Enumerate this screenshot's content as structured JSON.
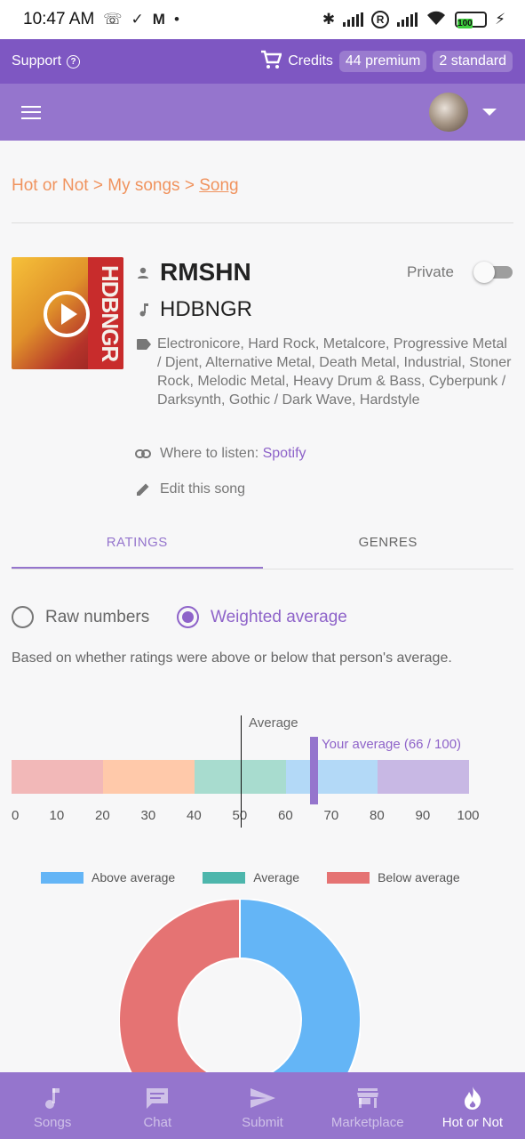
{
  "status_bar": {
    "time": "10:47 AM",
    "battery": "100"
  },
  "topbar": {
    "support_label": "Support",
    "credits_label": "Credits",
    "premium_chip": "44 premium",
    "standard_chip": "2 standard"
  },
  "breadcrumb": {
    "root": "Hot or Not",
    "sep1": " > ",
    "mid": "My songs",
    "sep2": " > ",
    "current": "Song"
  },
  "song": {
    "cover_text": "HDBNGR",
    "artist": "RMSHN",
    "title": "HDBNGR",
    "genres": "Electronicore, Hard Rock, Metalcore, Progressive Metal / Djent, Alternative Metal, Death Metal, Industrial, Stoner Rock, Melodic Metal, Heavy Drum & Bass, Cyberpunk / Darksynth, Gothic / Dark Wave, Hardstyle",
    "where_label": "Where to listen: ",
    "where_link": "Spotify",
    "edit_label": "Edit this song",
    "private_label": "Private",
    "private_on": false
  },
  "tabs": [
    {
      "label": "RATINGS",
      "active": true
    },
    {
      "label": "GENRES",
      "active": false
    }
  ],
  "ratings": {
    "radio_raw": "Raw numbers",
    "radio_weighted": "Weighted average",
    "selected": "weighted",
    "description": "Based on whether ratings were above or below that person's average.",
    "scale_ticks": [
      "0",
      "10",
      "20",
      "30",
      "40",
      "50",
      "60",
      "70",
      "80",
      "90",
      "100"
    ],
    "average_label": "Average",
    "average_value": 50,
    "your_average_label": "Your average (66 / 100)",
    "your_average_value": 66,
    "segments": [
      {
        "from": 0,
        "to": 20,
        "color": "#f2b8b8"
      },
      {
        "from": 20,
        "to": 40,
        "color": "#ffc9aa"
      },
      {
        "from": 40,
        "to": 60,
        "color": "#a8dccf"
      },
      {
        "from": 60,
        "to": 80,
        "color": "#b3d9f7"
      },
      {
        "from": 80,
        "to": 100,
        "color": "#c8b8e4"
      }
    ]
  },
  "chart_data": {
    "type": "pie",
    "series": [
      {
        "name": "Above average",
        "value": 50,
        "color": "#64b5f6"
      },
      {
        "name": "Average",
        "value": 0,
        "color": "#4db6ac"
      },
      {
        "name": "Below average",
        "value": 50,
        "color": "#e57373"
      }
    ]
  },
  "bottom_nav": [
    {
      "label": "Songs",
      "icon": "music-note-icon",
      "active": false
    },
    {
      "label": "Chat",
      "icon": "chat-icon",
      "active": false
    },
    {
      "label": "Submit",
      "icon": "send-icon",
      "active": false
    },
    {
      "label": "Marketplace",
      "icon": "store-icon",
      "active": false
    },
    {
      "label": "Hot or Not",
      "icon": "flame-icon",
      "active": true
    }
  ]
}
